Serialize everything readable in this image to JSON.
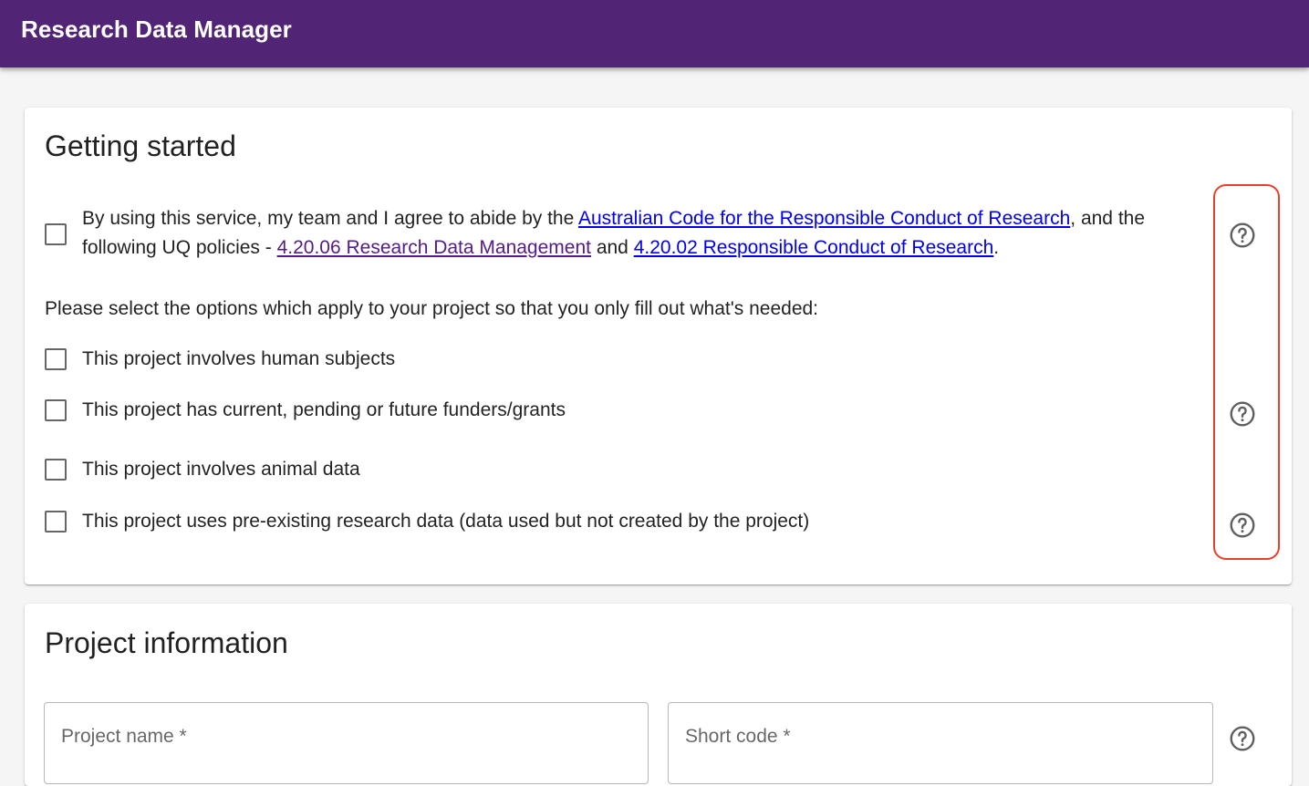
{
  "app": {
    "title": "Research Data Manager"
  },
  "getting_started": {
    "title": "Getting started",
    "agreement": {
      "text_before": "By using this service, my team and I agree to abide by the ",
      "link1": "Australian Code for the Responsible Conduct of Research",
      "text_middle": ", and the following UQ policies - ",
      "link2": "4.20.06 Research Data Management",
      "text_and": " and ",
      "link3": "4.20.02 Responsible Conduct of Research",
      "text_end": "."
    },
    "instructions": "Please select the options which apply to your project so that you only fill out what's needed:",
    "options": [
      {
        "label": "This project involves human subjects"
      },
      {
        "label": "This project has current, pending or future funders/grants"
      },
      {
        "label": "This project involves animal data"
      },
      {
        "label": "This project uses pre-existing research data (data used but not created by the project)"
      }
    ]
  },
  "project_information": {
    "title": "Project information",
    "fields": {
      "project_name": {
        "placeholder": "Project name *",
        "value": ""
      },
      "short_code": {
        "placeholder": "Short code *",
        "value": ""
      }
    }
  },
  "icons": {
    "help": "help-circle-outline-icon"
  },
  "colors": {
    "appbar": "#512476",
    "link_unvisited": "#0000ee",
    "link_visited": "#551a8b",
    "highlight_outline": "#e8402a"
  }
}
